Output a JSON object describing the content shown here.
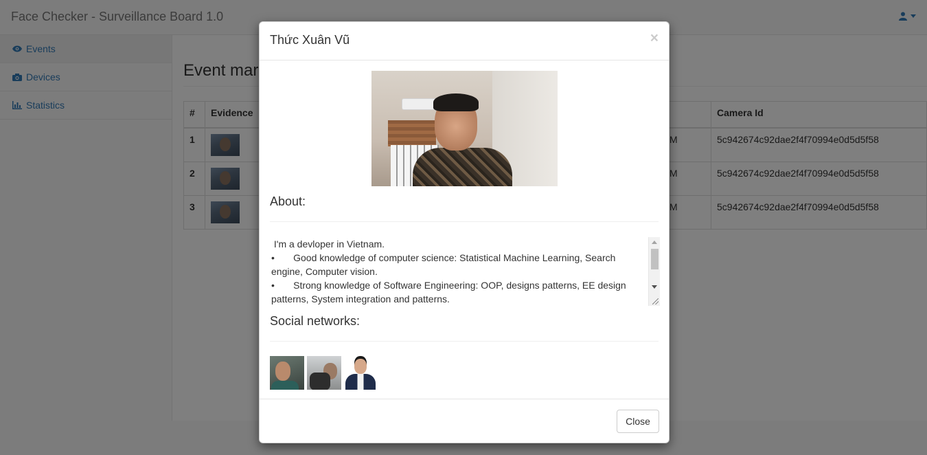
{
  "navbar": {
    "brand": "Face Checker - Surveillance Board 1.0",
    "user_icon": "user-icon"
  },
  "sidebar": {
    "items": [
      {
        "label": "Events",
        "icon": "eye-icon"
      },
      {
        "label": "Devices",
        "icon": "camera-icon"
      },
      {
        "label": "Statistics",
        "icon": "bar-chart-icon"
      }
    ]
  },
  "main": {
    "title": "Event mar",
    "table": {
      "headers": [
        "#",
        "Evidence",
        "",
        "Camera Id"
      ],
      "rows": [
        {
          "num": "1",
          "time_tail": "M",
          "camera_id": "5c942674c92dae2f4f70994e0d5d5f58"
        },
        {
          "num": "2",
          "time_tail": "M",
          "camera_id": "5c942674c92dae2f4f70994e0d5d5f58"
        },
        {
          "num": "3",
          "time_tail": "M",
          "camera_id": "5c942674c92dae2f4f70994e0d5d5f58"
        }
      ]
    }
  },
  "modal": {
    "title": "Thức Xuân Vũ",
    "close_symbol": "×",
    "about_title": "About:",
    "about_text": " I'm a devloper in Vietnam.\n•       Good knowledge of computer science: Statistical Machine Learning, Search engine, Computer vision.\n•       Strong knowledge of Software Engineering: OOP, designs patterns, EE design patterns, System integration and patterns.",
    "social_title": "Social networks:",
    "close_button": "Close"
  }
}
